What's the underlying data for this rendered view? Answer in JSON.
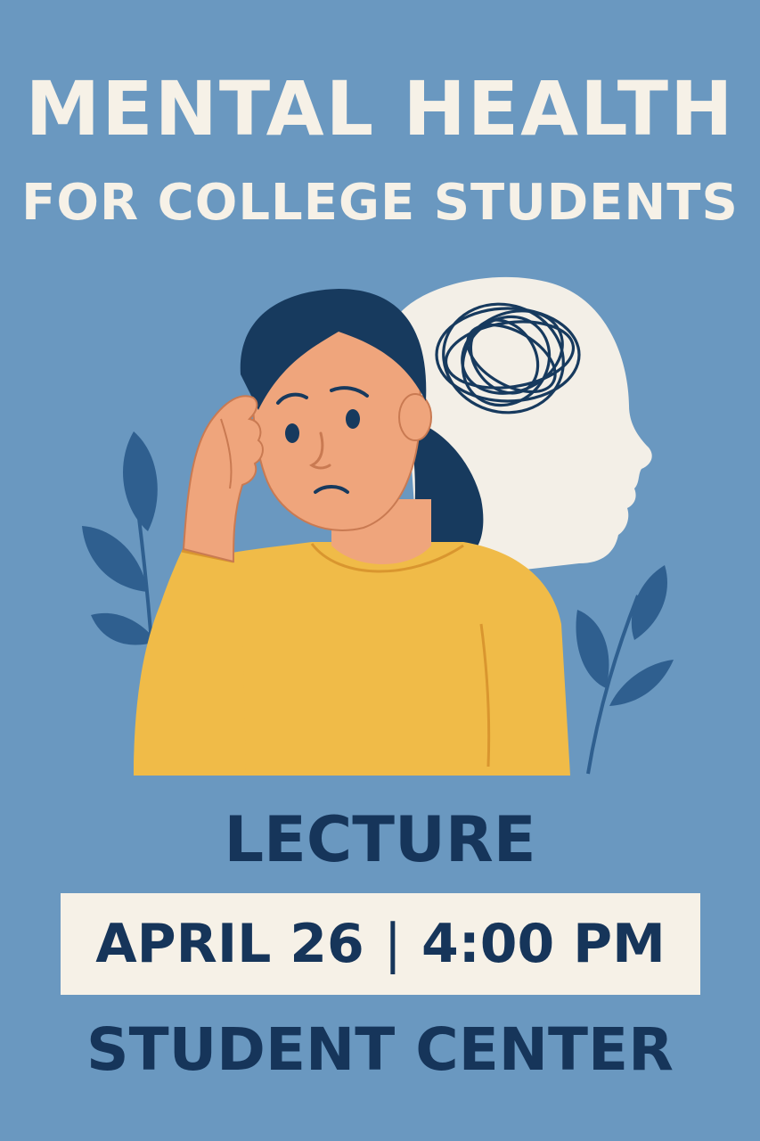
{
  "poster": {
    "title": "MENTAL HEALTH",
    "subtitle": "FOR COLLEGE STUDENTS",
    "event_type": "LECTURE",
    "date": "APRIL 26",
    "separator": "|",
    "time": "4:00 PM",
    "location": "STUDENT CENTER"
  },
  "colors": {
    "background": "#6a98c0",
    "title_text": "#f6f1e7",
    "dark_text": "#16355a",
    "banner": "#f6f1e7",
    "sweater": "#f0bb48",
    "skin": "#efa57c",
    "hair": "#173a5e",
    "leaves": "#2f5f8f",
    "head_silhouette": "#f3efe7"
  },
  "illustration": {
    "icons": [
      "stressed-student-illustration",
      "head-silhouette-icon",
      "tangled-thoughts-icon",
      "leaf-branch-icon"
    ]
  }
}
